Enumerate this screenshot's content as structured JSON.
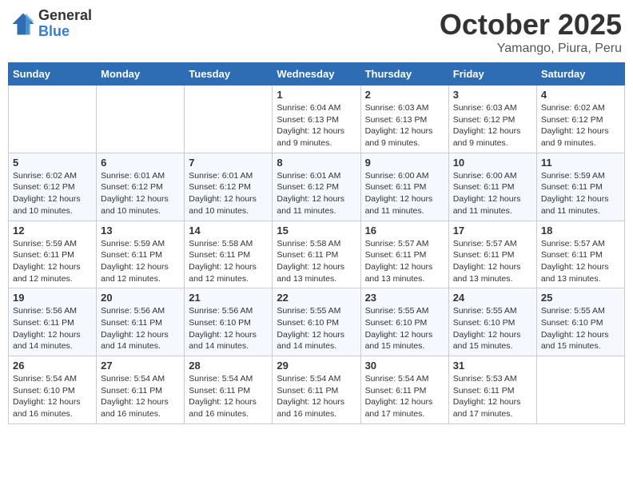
{
  "header": {
    "logo_general": "General",
    "logo_blue": "Blue",
    "title": "October 2025",
    "location": "Yamango, Piura, Peru"
  },
  "days_of_week": [
    "Sunday",
    "Monday",
    "Tuesday",
    "Wednesday",
    "Thursday",
    "Friday",
    "Saturday"
  ],
  "weeks": [
    {
      "days": [
        {
          "num": "",
          "info": ""
        },
        {
          "num": "",
          "info": ""
        },
        {
          "num": "",
          "info": ""
        },
        {
          "num": "1",
          "info": "Sunrise: 6:04 AM\nSunset: 6:13 PM\nDaylight: 12 hours\nand 9 minutes."
        },
        {
          "num": "2",
          "info": "Sunrise: 6:03 AM\nSunset: 6:13 PM\nDaylight: 12 hours\nand 9 minutes."
        },
        {
          "num": "3",
          "info": "Sunrise: 6:03 AM\nSunset: 6:12 PM\nDaylight: 12 hours\nand 9 minutes."
        },
        {
          "num": "4",
          "info": "Sunrise: 6:02 AM\nSunset: 6:12 PM\nDaylight: 12 hours\nand 9 minutes."
        }
      ]
    },
    {
      "days": [
        {
          "num": "5",
          "info": "Sunrise: 6:02 AM\nSunset: 6:12 PM\nDaylight: 12 hours\nand 10 minutes."
        },
        {
          "num": "6",
          "info": "Sunrise: 6:01 AM\nSunset: 6:12 PM\nDaylight: 12 hours\nand 10 minutes."
        },
        {
          "num": "7",
          "info": "Sunrise: 6:01 AM\nSunset: 6:12 PM\nDaylight: 12 hours\nand 10 minutes."
        },
        {
          "num": "8",
          "info": "Sunrise: 6:01 AM\nSunset: 6:12 PM\nDaylight: 12 hours\nand 11 minutes."
        },
        {
          "num": "9",
          "info": "Sunrise: 6:00 AM\nSunset: 6:11 PM\nDaylight: 12 hours\nand 11 minutes."
        },
        {
          "num": "10",
          "info": "Sunrise: 6:00 AM\nSunset: 6:11 PM\nDaylight: 12 hours\nand 11 minutes."
        },
        {
          "num": "11",
          "info": "Sunrise: 5:59 AM\nSunset: 6:11 PM\nDaylight: 12 hours\nand 11 minutes."
        }
      ]
    },
    {
      "days": [
        {
          "num": "12",
          "info": "Sunrise: 5:59 AM\nSunset: 6:11 PM\nDaylight: 12 hours\nand 12 minutes."
        },
        {
          "num": "13",
          "info": "Sunrise: 5:59 AM\nSunset: 6:11 PM\nDaylight: 12 hours\nand 12 minutes."
        },
        {
          "num": "14",
          "info": "Sunrise: 5:58 AM\nSunset: 6:11 PM\nDaylight: 12 hours\nand 12 minutes."
        },
        {
          "num": "15",
          "info": "Sunrise: 5:58 AM\nSunset: 6:11 PM\nDaylight: 12 hours\nand 13 minutes."
        },
        {
          "num": "16",
          "info": "Sunrise: 5:57 AM\nSunset: 6:11 PM\nDaylight: 12 hours\nand 13 minutes."
        },
        {
          "num": "17",
          "info": "Sunrise: 5:57 AM\nSunset: 6:11 PM\nDaylight: 12 hours\nand 13 minutes."
        },
        {
          "num": "18",
          "info": "Sunrise: 5:57 AM\nSunset: 6:11 PM\nDaylight: 12 hours\nand 13 minutes."
        }
      ]
    },
    {
      "days": [
        {
          "num": "19",
          "info": "Sunrise: 5:56 AM\nSunset: 6:11 PM\nDaylight: 12 hours\nand 14 minutes."
        },
        {
          "num": "20",
          "info": "Sunrise: 5:56 AM\nSunset: 6:11 PM\nDaylight: 12 hours\nand 14 minutes."
        },
        {
          "num": "21",
          "info": "Sunrise: 5:56 AM\nSunset: 6:10 PM\nDaylight: 12 hours\nand 14 minutes."
        },
        {
          "num": "22",
          "info": "Sunrise: 5:55 AM\nSunset: 6:10 PM\nDaylight: 12 hours\nand 14 minutes."
        },
        {
          "num": "23",
          "info": "Sunrise: 5:55 AM\nSunset: 6:10 PM\nDaylight: 12 hours\nand 15 minutes."
        },
        {
          "num": "24",
          "info": "Sunrise: 5:55 AM\nSunset: 6:10 PM\nDaylight: 12 hours\nand 15 minutes."
        },
        {
          "num": "25",
          "info": "Sunrise: 5:55 AM\nSunset: 6:10 PM\nDaylight: 12 hours\nand 15 minutes."
        }
      ]
    },
    {
      "days": [
        {
          "num": "26",
          "info": "Sunrise: 5:54 AM\nSunset: 6:10 PM\nDaylight: 12 hours\nand 16 minutes."
        },
        {
          "num": "27",
          "info": "Sunrise: 5:54 AM\nSunset: 6:11 PM\nDaylight: 12 hours\nand 16 minutes."
        },
        {
          "num": "28",
          "info": "Sunrise: 5:54 AM\nSunset: 6:11 PM\nDaylight: 12 hours\nand 16 minutes."
        },
        {
          "num": "29",
          "info": "Sunrise: 5:54 AM\nSunset: 6:11 PM\nDaylight: 12 hours\nand 16 minutes."
        },
        {
          "num": "30",
          "info": "Sunrise: 5:54 AM\nSunset: 6:11 PM\nDaylight: 12 hours\nand 17 minutes."
        },
        {
          "num": "31",
          "info": "Sunrise: 5:53 AM\nSunset: 6:11 PM\nDaylight: 12 hours\nand 17 minutes."
        },
        {
          "num": "",
          "info": ""
        }
      ]
    }
  ]
}
